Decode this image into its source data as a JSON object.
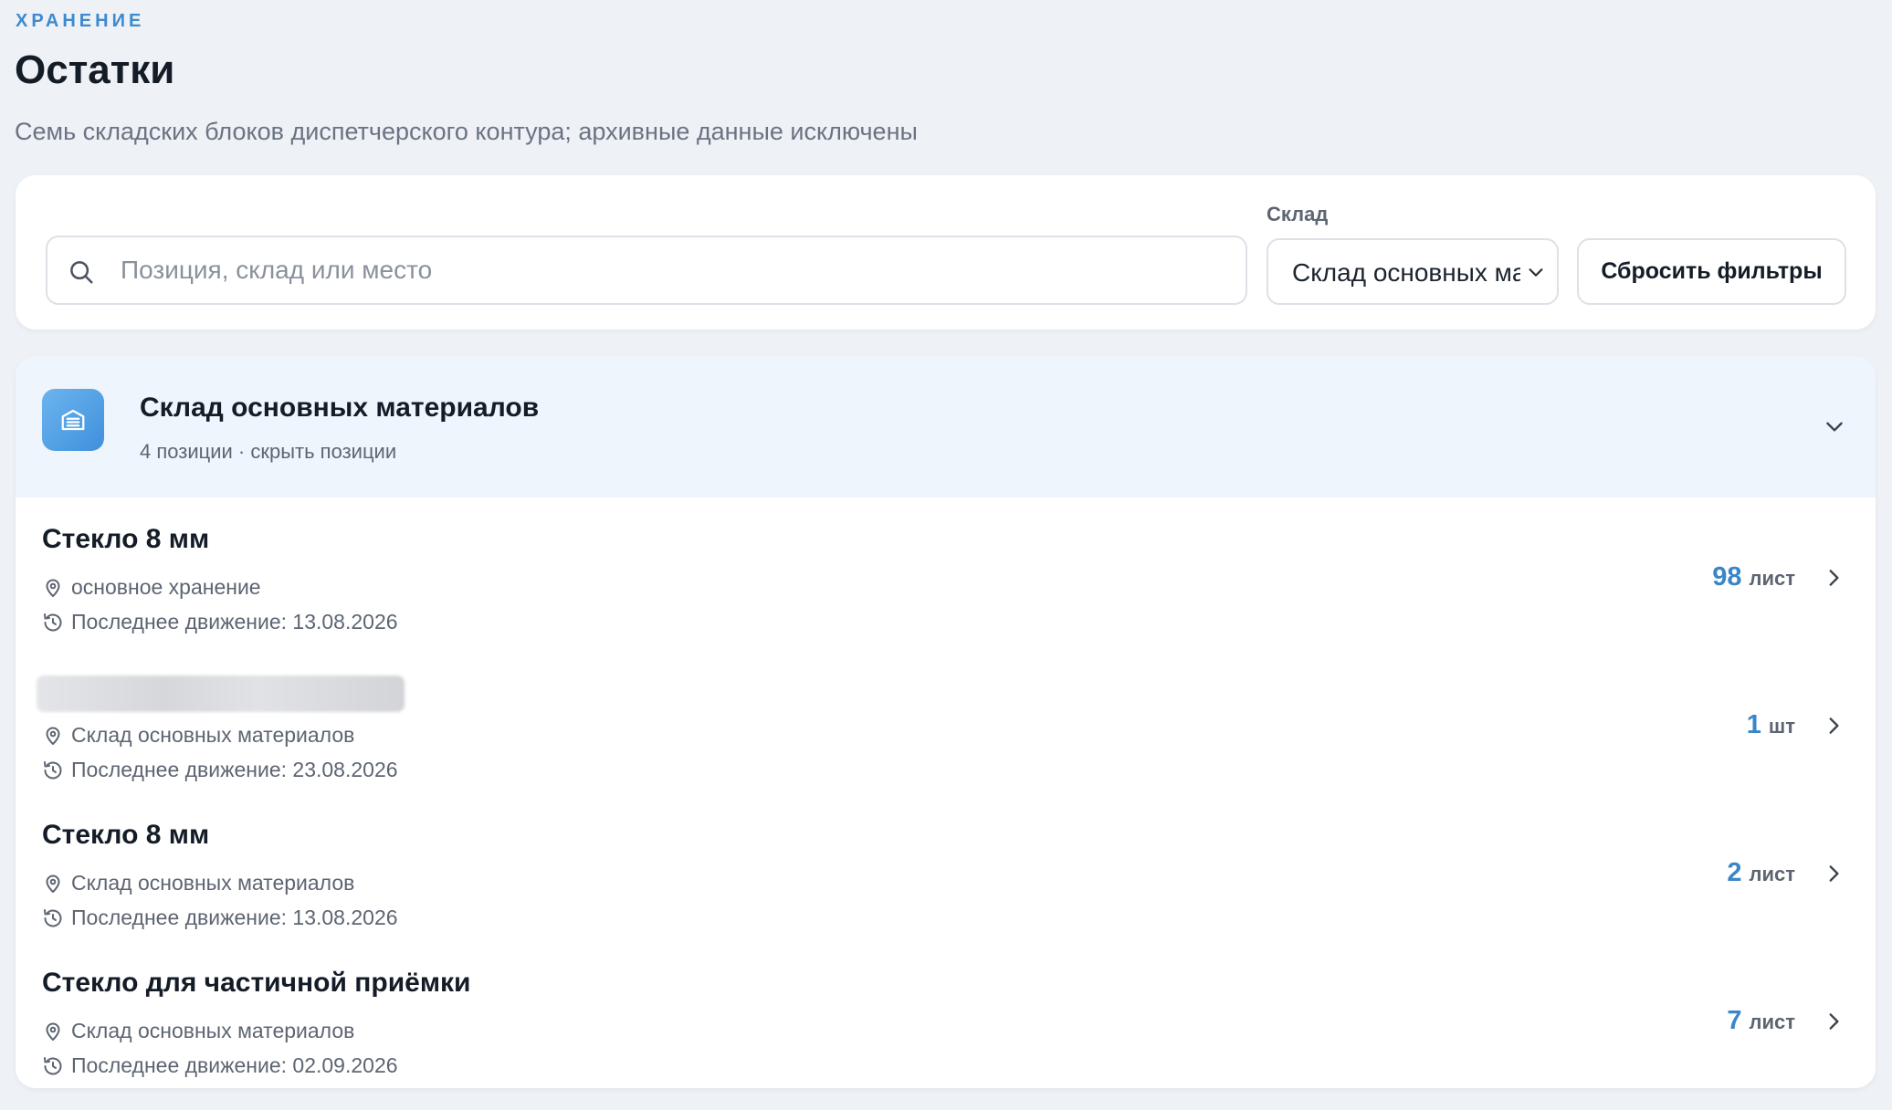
{
  "header": {
    "eyebrow": "ХРАНЕНИЕ",
    "title": "Остатки",
    "subtitle": "Семь складских блоков диспетчерского контура; архивные данные исключены"
  },
  "filters": {
    "search_placeholder": "Позиция, склад или место",
    "search_value": "",
    "warehouse_label": "Склад",
    "warehouse_selected": "Склад основных материалов",
    "reset_label": "Сбросить фильтры"
  },
  "warehouse": {
    "title": "Склад основных материалов",
    "meta": "4 позиции · скрыть позиции",
    "icon": "warehouse-icon",
    "items": [
      {
        "name": "Стекло 8 мм",
        "location": "основное хранение",
        "last_move": "Последнее движение: 13.08.2026",
        "qty": "98",
        "unit": "лист"
      },
      {
        "name": "",
        "name_redacted": true,
        "location": "Склад основных материалов",
        "last_move": "Последнее движение: 23.08.2026",
        "qty": "1",
        "unit": "шт"
      },
      {
        "name": "Стекло 8 мм",
        "location": "Склад основных материалов",
        "last_move": "Последнее движение: 13.08.2026",
        "qty": "2",
        "unit": "лист"
      },
      {
        "name": "Стекло для частичной приёмки",
        "location": "Склад основных материалов",
        "last_move": "Последнее движение: 02.09.2026",
        "qty": "7",
        "unit": "лист"
      }
    ]
  },
  "colors": {
    "accent": "#3a86c8",
    "background": "#eef1f6",
    "header_tint": "#eef5fd"
  }
}
